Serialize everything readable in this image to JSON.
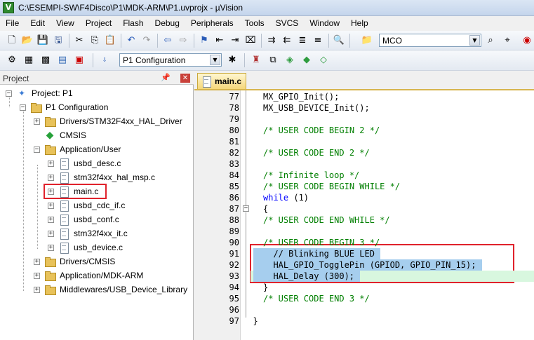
{
  "window": {
    "title": "C:\\ESEMPI-SW\\F4Disco\\P1\\MDK-ARM\\P1.uvprojx - µVision"
  },
  "menu": [
    "File",
    "Edit",
    "View",
    "Project",
    "Flash",
    "Debug",
    "Peripherals",
    "Tools",
    "SVCS",
    "Window",
    "Help"
  ],
  "toolbar": {
    "search_combo_value": "MCO",
    "target_combo_value": "P1 Configuration"
  },
  "project_pane": {
    "title": "Project",
    "tree": [
      {
        "label": "Project: P1",
        "level": 0,
        "icon": "project-icon",
        "expander": "−"
      },
      {
        "label": "P1 Configuration",
        "level": 1,
        "icon": "folder-icon",
        "expander": "−"
      },
      {
        "label": "Drivers/STM32F4xx_HAL_Driver",
        "level": 2,
        "icon": "folder-icon",
        "expander": "+"
      },
      {
        "label": "CMSIS",
        "level": 2,
        "icon": "diamond-icon",
        "expander": ""
      },
      {
        "label": "Application/User",
        "level": 2,
        "icon": "folder-icon",
        "expander": "−"
      },
      {
        "label": "usbd_desc.c",
        "level": 3,
        "icon": "file-icon",
        "expander": "+"
      },
      {
        "label": "stm32f4xx_hal_msp.c",
        "level": 3,
        "icon": "file-icon",
        "expander": "+"
      },
      {
        "label": "main.c",
        "level": 3,
        "icon": "file-icon",
        "expander": "+",
        "highlighted": true
      },
      {
        "label": "usbd_cdc_if.c",
        "level": 3,
        "icon": "file-icon",
        "expander": "+"
      },
      {
        "label": "usbd_conf.c",
        "level": 3,
        "icon": "file-icon",
        "expander": "+"
      },
      {
        "label": "stm32f4xx_it.c",
        "level": 3,
        "icon": "file-icon",
        "expander": "+"
      },
      {
        "label": "usb_device.c",
        "level": 3,
        "icon": "file-icon",
        "expander": "+"
      },
      {
        "label": "Drivers/CMSIS",
        "level": 2,
        "icon": "folder-icon",
        "expander": "+"
      },
      {
        "label": "Application/MDK-ARM",
        "level": 2,
        "icon": "folder-icon",
        "expander": "+"
      },
      {
        "label": "Middlewares/USB_Device_Library",
        "level": 2,
        "icon": "folder-icon",
        "expander": "+"
      }
    ]
  },
  "editor": {
    "tab_label": "main.c",
    "lines": [
      {
        "n": "77",
        "text": "MX_GPIO_Init();",
        "indent": 2,
        "kind": "code"
      },
      {
        "n": "78",
        "text": "MX_USB_DEVICE_Init();",
        "indent": 2,
        "kind": "code"
      },
      {
        "n": "79",
        "text": "",
        "indent": 0,
        "kind": "code"
      },
      {
        "n": "80",
        "text": "/* USER CODE BEGIN 2 */",
        "indent": 2,
        "kind": "comment"
      },
      {
        "n": "81",
        "text": "",
        "indent": 0,
        "kind": "code"
      },
      {
        "n": "82",
        "text": "/* USER CODE END 2 */",
        "indent": 2,
        "kind": "comment"
      },
      {
        "n": "83",
        "text": "",
        "indent": 0,
        "kind": "code"
      },
      {
        "n": "84",
        "text": "/* Infinite loop */",
        "indent": 2,
        "kind": "comment"
      },
      {
        "n": "85",
        "text": "/* USER CODE BEGIN WHILE */",
        "indent": 2,
        "kind": "comment"
      },
      {
        "n": "86",
        "text": "while (1)",
        "indent": 2,
        "kind": "while"
      },
      {
        "n": "87",
        "text": "{",
        "indent": 2,
        "kind": "code"
      },
      {
        "n": "88",
        "text": "/* USER CODE END WHILE */",
        "indent": 2,
        "kind": "comment"
      },
      {
        "n": "89",
        "text": "",
        "indent": 0,
        "kind": "code"
      },
      {
        "n": "90",
        "text": "/* USER CODE BEGIN 3 */",
        "indent": 2,
        "kind": "comment"
      },
      {
        "n": "91",
        "text": "// Blinking BLUE LED",
        "indent": 4,
        "kind": "selected"
      },
      {
        "n": "92",
        "text": "HAL_GPIO_TogglePin (GPIOD, GPIO_PIN_15);",
        "indent": 4,
        "kind": "selected"
      },
      {
        "n": "93",
        "text": "HAL_Delay (300);",
        "indent": 4,
        "kind": "selected-current"
      },
      {
        "n": "94",
        "text": "}",
        "indent": 2,
        "kind": "code"
      },
      {
        "n": "95",
        "text": "/* USER CODE END 3 */",
        "indent": 2,
        "kind": "comment"
      },
      {
        "n": "96",
        "text": "",
        "indent": 0,
        "kind": "code"
      },
      {
        "n": "97",
        "text": "}",
        "indent": 0,
        "kind": "code"
      }
    ]
  },
  "colors": {
    "highlight_border": "#e0222c",
    "selection": "#a6ceee",
    "current_line": "#d8f7df",
    "comment": "#007f00",
    "keyword": "#0000ff"
  }
}
